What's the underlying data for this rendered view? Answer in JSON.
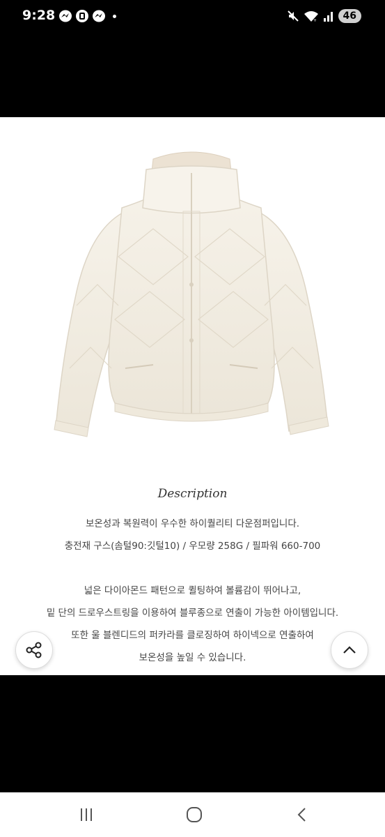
{
  "status_bar": {
    "time": "9:28",
    "battery": "46",
    "left_icons": [
      "messenger-icon",
      "app-icon",
      "messenger-icon"
    ],
    "right_icons": [
      "mute-icon",
      "wifi-icon",
      "signal-icon"
    ]
  },
  "product": {
    "image": "cream-puffer-jacket",
    "description_title": "Description",
    "lines": [
      "보온성과 복원력이 우수한 하이퀄리티 다운점퍼입니다.",
      "충전재 구스(솜털90:깃털10) / 우모량 258G / 필파워 660-700",
      "넓은 다이아몬드 패턴으로 퀼팅하여 볼륨감이 뛰어나고,",
      "밑 단의 드로우스트링을 이용하여 블루종으로 연출이 가능한 아이템입니다.",
      "또한 울 블렌디드의 퍼카라를 클로징하여 하이넥으로 연출하여",
      "보온성을 높일 수 있습니다."
    ]
  },
  "buttons": {
    "share": "share-icon",
    "scroll_top": "chevron-up-icon"
  },
  "nav": {
    "recents": "recents-icon",
    "home": "home-icon",
    "back": "back-icon"
  },
  "colors": {
    "jacket": "#f3eee3",
    "fur": "#ece2d3",
    "background": "#ffffff"
  }
}
